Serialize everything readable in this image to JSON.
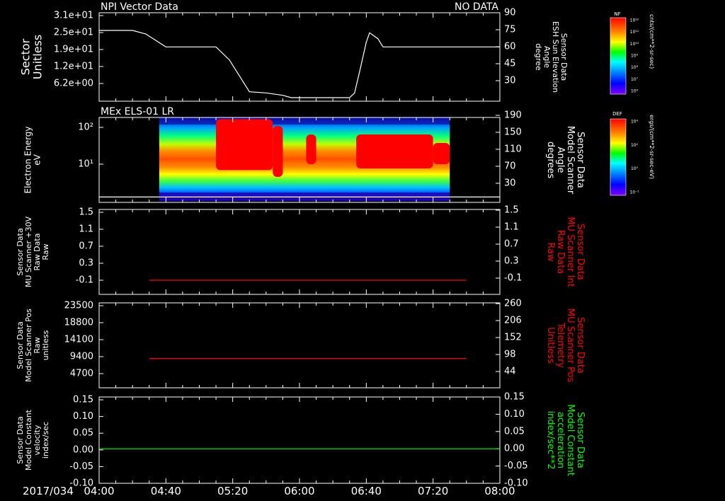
{
  "date_label": "2017/034",
  "time_ticks": [
    "04:00",
    "04:40",
    "05:20",
    "06:00",
    "06:40",
    "07:20",
    "08:00"
  ],
  "colors": {
    "white": "#ffffff",
    "red": "#ff0000",
    "green": "#00ff00",
    "background": "#000000"
  },
  "chart_data": [
    {
      "type": "line",
      "panel": "npi",
      "title_left": "NPI Vector Data",
      "title_right": "NO DATA",
      "ylabel_left": [
        "Sector",
        "Unitless"
      ],
      "left_ticks": [
        "3.1e+01",
        "2.5e+01",
        "1.9e+01",
        "1.2e+01",
        "6.2e+00"
      ],
      "ylabel_right": [
        "Sensor Data",
        "ESH Sun Elevation",
        "Angle",
        "degree"
      ],
      "right_ticks": [
        "90",
        "75",
        "60",
        "45",
        "30"
      ],
      "ylim": [
        15,
        90
      ],
      "series": [
        {
          "color": "#ffffff",
          "x": [
            "04:00",
            "04:20",
            "04:28",
            "04:40",
            "05:00",
            "05:06",
            "05:10",
            "05:18",
            "05:30",
            "05:40",
            "05:50",
            "05:55",
            "06:10",
            "06:30",
            "06:33",
            "06:36",
            "06:40",
            "06:42",
            "06:47",
            "06:50",
            "07:00",
            "07:30",
            "08:00"
          ],
          "y": [
            75,
            75,
            72,
            61,
            61,
            61,
            61,
            50,
            23,
            22,
            20,
            18,
            18,
            18,
            22,
            40,
            65,
            73,
            68,
            61,
            61,
            61,
            61
          ]
        }
      ]
    },
    {
      "type": "heatmap",
      "panel": "els",
      "title_left": "MEx ELS-01 LR",
      "ylabel_left": [
        "Electron Energy",
        "eV"
      ],
      "left_ticks": [
        "10²",
        "10¹"
      ],
      "ylabel_right": [
        "Sensor Data",
        "Model Scanner",
        "Angle",
        "degrees"
      ],
      "right_ticks": [
        "190",
        "150",
        "110",
        "70",
        "30"
      ],
      "data_start": "04:36",
      "data_end": "07:30",
      "colorbar_label": "ergs/(cm**2-sr-sec-eV)",
      "colorbar_title": "DEF",
      "colorbar_ticks": [
        "10⁴",
        "10²",
        "10⁰",
        "10⁻¹"
      ],
      "series": [
        {
          "color": "#ffffff",
          "x": [
            "04:00",
            "08:00"
          ],
          "y": [
            12,
            12
          ]
        }
      ]
    },
    {
      "type": "line",
      "panel": "mu30",
      "ylabel_left": [
        "Sensor Data",
        "MU Scanner +30V",
        "Raw Data",
        "Raw"
      ],
      "left_ticks": [
        "1.5",
        "1.1",
        "0.7",
        "0.3",
        "-0.1"
      ],
      "ylabel_right": [
        "Sensor Data",
        "MU Scanner Int",
        "Raw Data",
        "Raw"
      ],
      "right_ticks": [
        "1.5",
        "1.1",
        "0.7",
        "0.3",
        "-0.1"
      ],
      "ylim": [
        -0.3,
        1.5
      ],
      "series": [
        {
          "color": "#ff0000",
          "x": [
            "04:30",
            "07:40"
          ],
          "y": [
            0.0,
            0.0
          ]
        }
      ]
    },
    {
      "type": "line",
      "panel": "pos",
      "ylabel_left": [
        "Sensor Data",
        "Model Scanner Pos",
        "Raw",
        "unitless"
      ],
      "left_ticks": [
        "23500",
        "18800",
        "14100",
        "9400",
        "4700"
      ],
      "ylabel_right": [
        "Sensor Data",
        "MU Scanner Pos",
        "Telemetry",
        "Unitless"
      ],
      "right_ticks": [
        "260",
        "206",
        "152",
        "98",
        "44"
      ],
      "ylim": [
        0,
        23500
      ],
      "series": [
        {
          "color": "#ff0000",
          "x": [
            "04:30",
            "07:40"
          ],
          "y": [
            8100,
            8100
          ]
        }
      ]
    },
    {
      "type": "line",
      "panel": "vel",
      "ylabel_left": [
        "Sensor Data",
        "Model Constant",
        "velocity",
        "index/sec"
      ],
      "left_ticks": [
        "0.15",
        "0.10",
        "0.05",
        "0.00",
        "-0.05",
        "-0.10"
      ],
      "ylabel_right": [
        "Sensor Data",
        "Model Constant",
        "acceleration",
        "index/sec**2"
      ],
      "right_ticks": [
        "0.15",
        "0.10",
        "0.05",
        "0.00",
        "-0.05",
        "-0.10"
      ],
      "ylim": [
        -0.1,
        0.15
      ],
      "series": [
        {
          "color": "#00ff00",
          "x": [
            "04:00",
            "08:00"
          ],
          "y": [
            0.0,
            0.0
          ]
        }
      ]
    }
  ],
  "colorbar_npi": {
    "title": "NF",
    "label": "cnts/(cm**2-sr-sec)",
    "ticks": [
      "10¹²",
      "10¹¹",
      "10¹⁰",
      "10⁹",
      "10⁸",
      "10⁷",
      "10⁶"
    ]
  }
}
